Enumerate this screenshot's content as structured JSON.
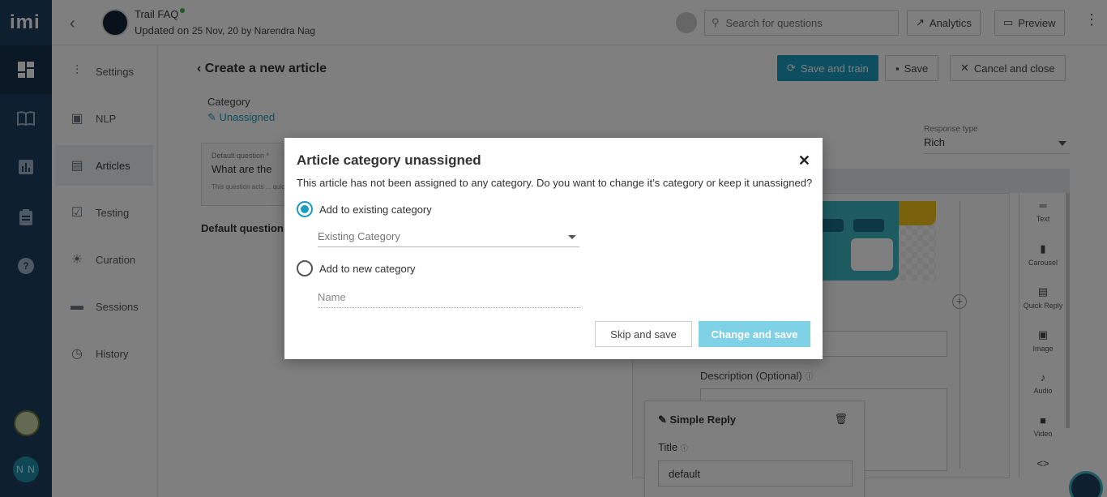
{
  "app": {
    "logo": "imi"
  },
  "rail": {
    "icons": [
      "dashboard-icon",
      "book-icon",
      "chart-icon",
      "clipboard-icon",
      "help-icon"
    ],
    "user_initials": "N N"
  },
  "topbar": {
    "bot_name": "Trail FAQ",
    "updated_prefix": "Updated on",
    "updated_date": "25 Nov, 20",
    "updated_by": "by Narendra Nag",
    "search_placeholder": "Search for questions",
    "analytics_label": "Analytics",
    "preview_label": "Preview"
  },
  "sidebar": {
    "items": [
      {
        "label": "Settings",
        "icon": "sliders-icon"
      },
      {
        "label": "NLP",
        "icon": "chip-icon"
      },
      {
        "label": "Articles",
        "icon": "document-icon"
      },
      {
        "label": "Testing",
        "icon": "clipboard-check-icon"
      },
      {
        "label": "Curation",
        "icon": "bulb-icon"
      },
      {
        "label": "Sessions",
        "icon": "chat-icon"
      },
      {
        "label": "History",
        "icon": "clock-icon"
      }
    ],
    "active": "Articles"
  },
  "main": {
    "page_title": "Create a new article",
    "save_train_label": "Save and train",
    "save_label": "Save",
    "cancel_label": "Cancel and close",
    "category_label": "Category",
    "category_value": "Unassigned",
    "default_question_label": "Default question *",
    "default_question_value": "What are the",
    "default_question_hint": "This question acts ... quick replies.",
    "default_question_heading": "Default question",
    "response_type_label": "Response type",
    "response_type_value": "Rich",
    "description_label": "Description (Optional)",
    "tools": [
      {
        "label": "Text",
        "icon": "text-icon"
      },
      {
        "label": "Carousel",
        "icon": "carousel-icon"
      },
      {
        "label": "Quick Reply",
        "icon": "quick-reply-icon"
      },
      {
        "label": "Image",
        "icon": "image-icon"
      },
      {
        "label": "Audio",
        "icon": "audio-icon"
      },
      {
        "label": "Video",
        "icon": "video-icon"
      },
      {
        "label": "",
        "icon": "code-icon"
      }
    ],
    "simple_reply": {
      "heading": "Simple Reply",
      "title_label": "Title",
      "title_value": "default"
    }
  },
  "modal": {
    "title": "Article category unassigned",
    "message": "This article has not been assigned to any category. Do you want to change it’s category or keep it unassigned?",
    "option_existing": "Add to existing category",
    "existing_placeholder": "Existing Category",
    "option_new": "Add to new category",
    "name_placeholder": "Name",
    "selected_option": "existing",
    "skip_label": "Skip and save",
    "change_label": "Change and save"
  },
  "colors": {
    "rail_bg": "#1d3f5e",
    "accent": "#1a9cc0",
    "disabled_accent": "#7fd1e6"
  }
}
